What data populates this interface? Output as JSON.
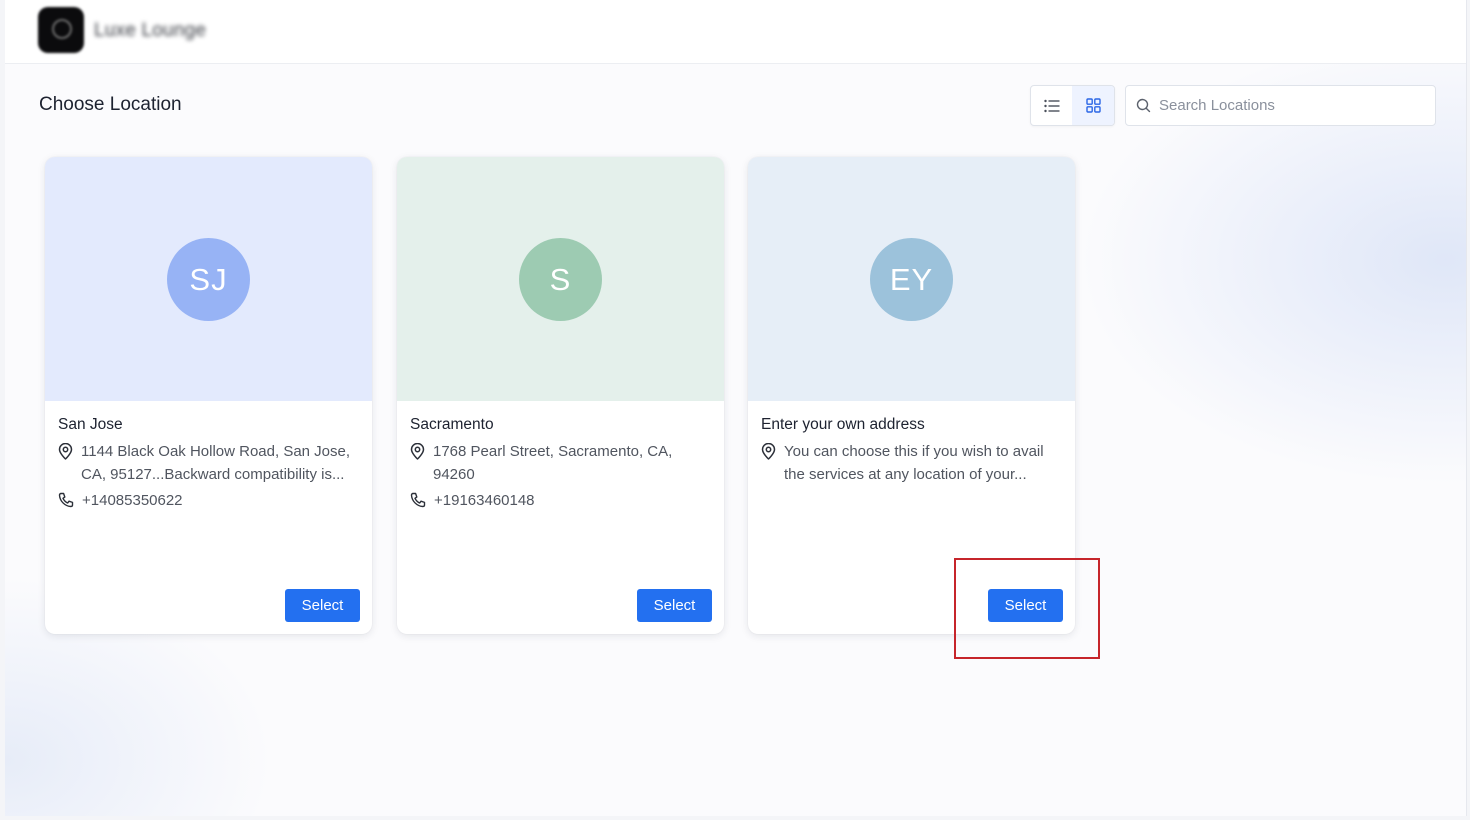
{
  "header": {
    "brand_name": "Luxe Lounge"
  },
  "page": {
    "title": "Choose Location"
  },
  "view_toggle": {
    "options": [
      "list-view-icon",
      "grid-view-icon"
    ],
    "active": "grid"
  },
  "search": {
    "placeholder": "Search Locations",
    "value": ""
  },
  "cards": [
    {
      "initials": "SJ",
      "avatar_color": "#97b3f5",
      "banner_color": "#e3eafd",
      "name": "San Jose",
      "address": "1144 Black Oak Hollow Road, San Jose, CA, 95127...Backward compatibility is...",
      "phone": "+14085350622",
      "button_label": "Select"
    },
    {
      "initials": "S",
      "avatar_color": "#9dcbb2",
      "banner_color": "#e4f0eb",
      "name": "Sacramento",
      "address": "1768 Pearl Street, Sacramento, CA, 94260",
      "phone": "+19163460148",
      "button_label": "Select"
    },
    {
      "initials": "EY",
      "avatar_color": "#9cc2db",
      "banner_color": "#e6eef7",
      "name": "Enter your own address",
      "address": "You can choose this if you wish to avail the services at any location of your...",
      "phone": "",
      "button_label": "Select"
    }
  ],
  "colors": {
    "accent": "#2370f0",
    "highlight_box": "#c6252b"
  }
}
